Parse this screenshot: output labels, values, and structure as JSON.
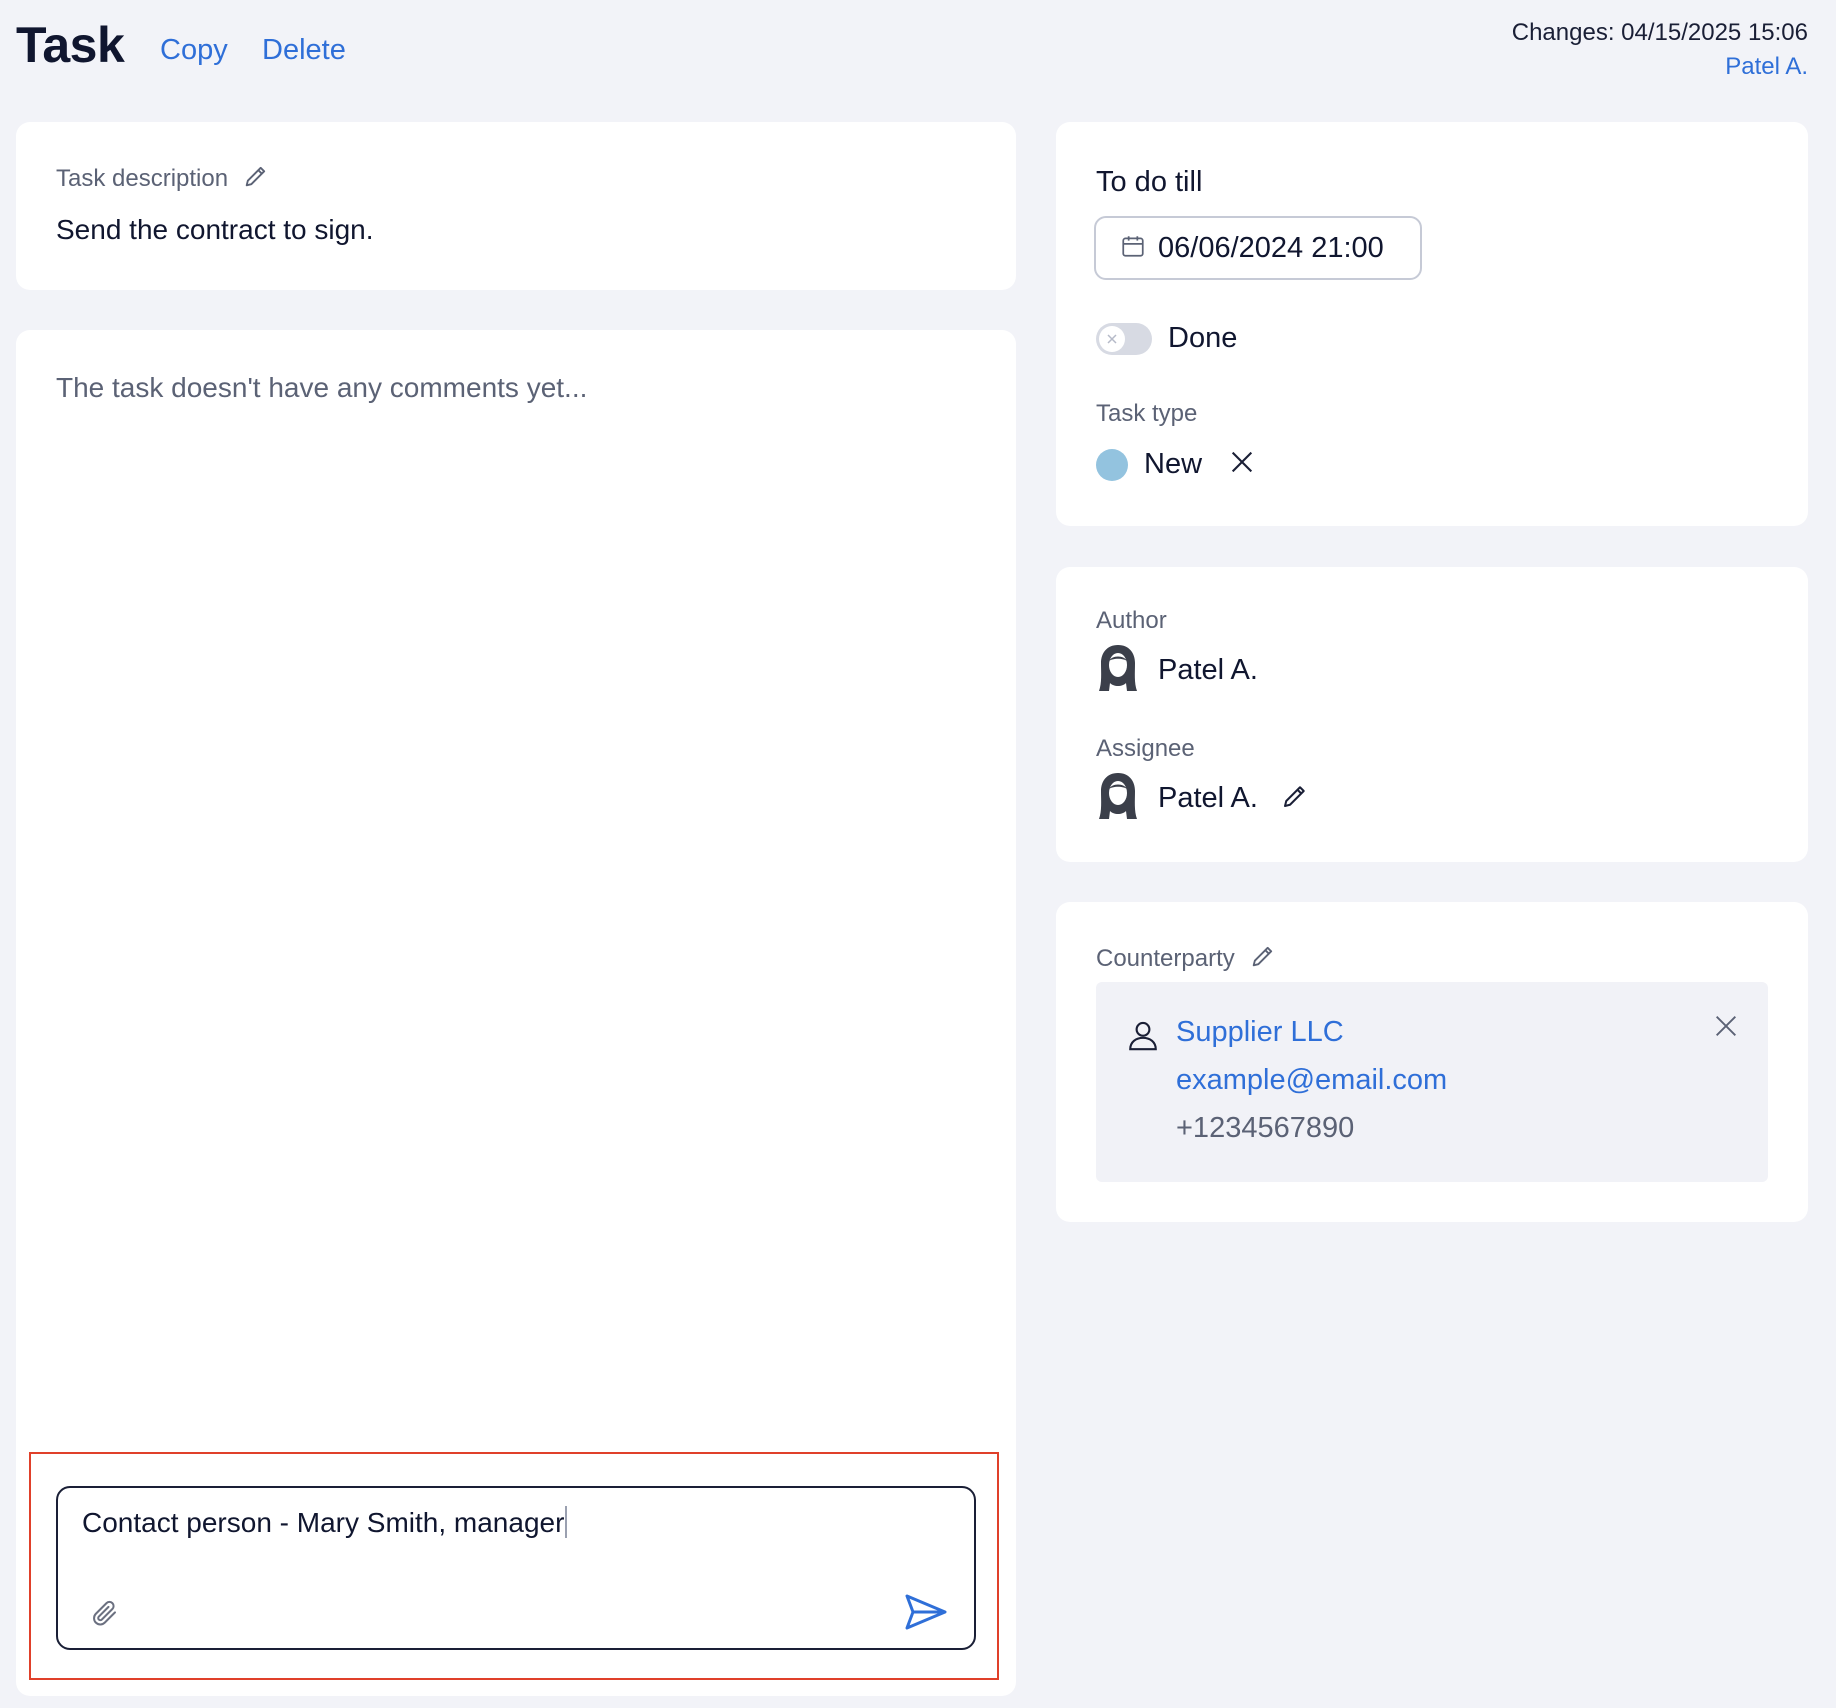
{
  "header": {
    "title": "Task",
    "copy_label": "Copy",
    "delete_label": "Delete",
    "changes_text": "Changes: 04/15/2025 15:06",
    "changed_by": "Patel A."
  },
  "description": {
    "label": "Task description",
    "text": "Send the contract to sign."
  },
  "comments": {
    "empty_text": "The task doesn't have any comments yet...",
    "composer_value": "Contact person - Mary Smith, manager"
  },
  "deadline": {
    "label": "To do till",
    "date_value": "06/06/2024 21:00",
    "done_label": "Done",
    "done": false
  },
  "task_type": {
    "label": "Task type",
    "value": "New",
    "color": "#93c3df"
  },
  "people": {
    "author_label": "Author",
    "author_name": "Patel A.",
    "assignee_label": "Assignee",
    "assignee_name": "Patel A."
  },
  "counterparty": {
    "label": "Counterparty",
    "name": "Supplier LLC",
    "email": "example@email.com",
    "phone": "+1234567890"
  },
  "colors": {
    "accent": "#2f6fd8",
    "highlight": "#e0402a",
    "background": "#f2f3f8"
  },
  "icons": [
    "pencil-icon",
    "calendar-icon",
    "close-icon",
    "avatar-icon",
    "user-icon",
    "paperclip-icon",
    "send-icon"
  ]
}
